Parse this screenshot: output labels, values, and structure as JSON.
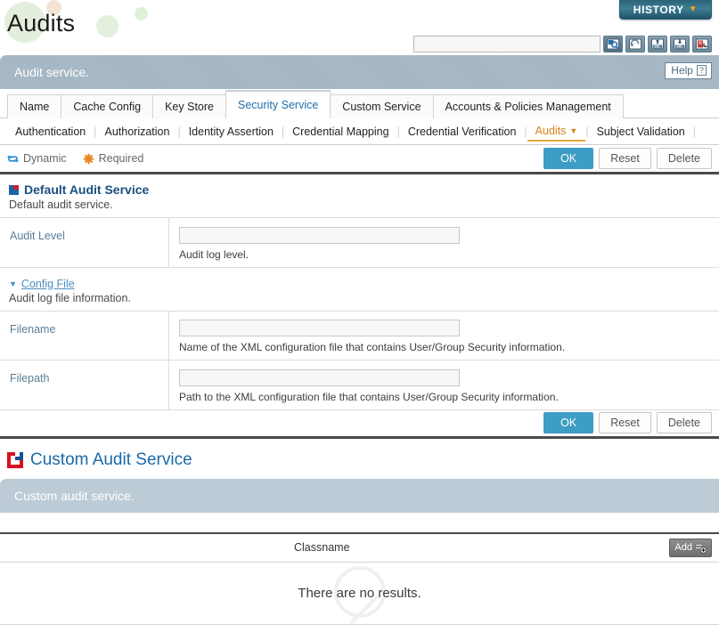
{
  "header": {
    "page_title": "Audits",
    "history_button": "HISTORY",
    "history_caret": "chevron-down-icon",
    "search_value": "",
    "search_placeholder": "",
    "toolbar_icons": [
      {
        "name": "search-icon",
        "active": true
      },
      {
        "name": "refresh-icon",
        "active": false
      },
      {
        "name": "xml-upload-icon",
        "active": false
      },
      {
        "name": "xml-download-icon",
        "active": false
      },
      {
        "name": "export-report-icon",
        "active": false
      }
    ]
  },
  "service_header": {
    "title": "Audit service.",
    "help_label": "Help",
    "help_glyph": "?"
  },
  "tabs": [
    {
      "label": "Name",
      "active": false
    },
    {
      "label": "Cache Config",
      "active": false
    },
    {
      "label": "Key Store",
      "active": false
    },
    {
      "label": "Security Service",
      "active": true
    },
    {
      "label": "Custom Service",
      "active": false
    },
    {
      "label": "Accounts & Policies Management",
      "active": false
    }
  ],
  "subtabs": [
    {
      "label": "Authentication",
      "active": false
    },
    {
      "label": "Authorization",
      "active": false
    },
    {
      "label": "Identity Assertion",
      "active": false
    },
    {
      "label": "Credential Mapping",
      "active": false
    },
    {
      "label": "Credential Verification",
      "active": false
    },
    {
      "label": "Audits",
      "active": true
    },
    {
      "label": "Subject Validation",
      "active": false
    }
  ],
  "legend": {
    "dynamic_label": "Dynamic",
    "dynamic_icon": "dynamic-cycle-icon",
    "required_label": "Required",
    "required_icon": "required-asterisk-icon"
  },
  "actions": {
    "ok": "OK",
    "reset": "Reset",
    "delete": "Delete"
  },
  "default_section": {
    "title": "Default Audit Service",
    "subtitle": "Default audit service.",
    "rows": [
      {
        "label": "Audit Level",
        "value": "",
        "hint": "Audit log level."
      }
    ]
  },
  "config_file": {
    "toggle_label": "Config File",
    "toggle_icon": "triangle-down-icon",
    "subtitle": "Audit log file information.",
    "rows": [
      {
        "label": "Filename",
        "value": "",
        "hint": "Name of the XML configuration file that contains User/Group Security information."
      },
      {
        "label": "Filepath",
        "value": "",
        "hint": "Path to the XML configuration file that contains User/Group Security information."
      }
    ]
  },
  "custom_section": {
    "title": "Custom Audit Service",
    "bar_text": "Custom audit service.",
    "column_header": "Classname",
    "add_label": "Add",
    "add_icon": "add-plus-icon",
    "empty_message": "There are no results."
  },
  "colors": {
    "accent_blue": "#3d9dc4",
    "header_blue_gray": "#9fb2c0",
    "custom_bar": "#bccbd6",
    "active_tab_text": "#1f6fa8",
    "subtab_active": "#d58512",
    "section_title": "#1b4f80",
    "required_orange": "#e8861e",
    "history_teal": "#2b6378"
  }
}
